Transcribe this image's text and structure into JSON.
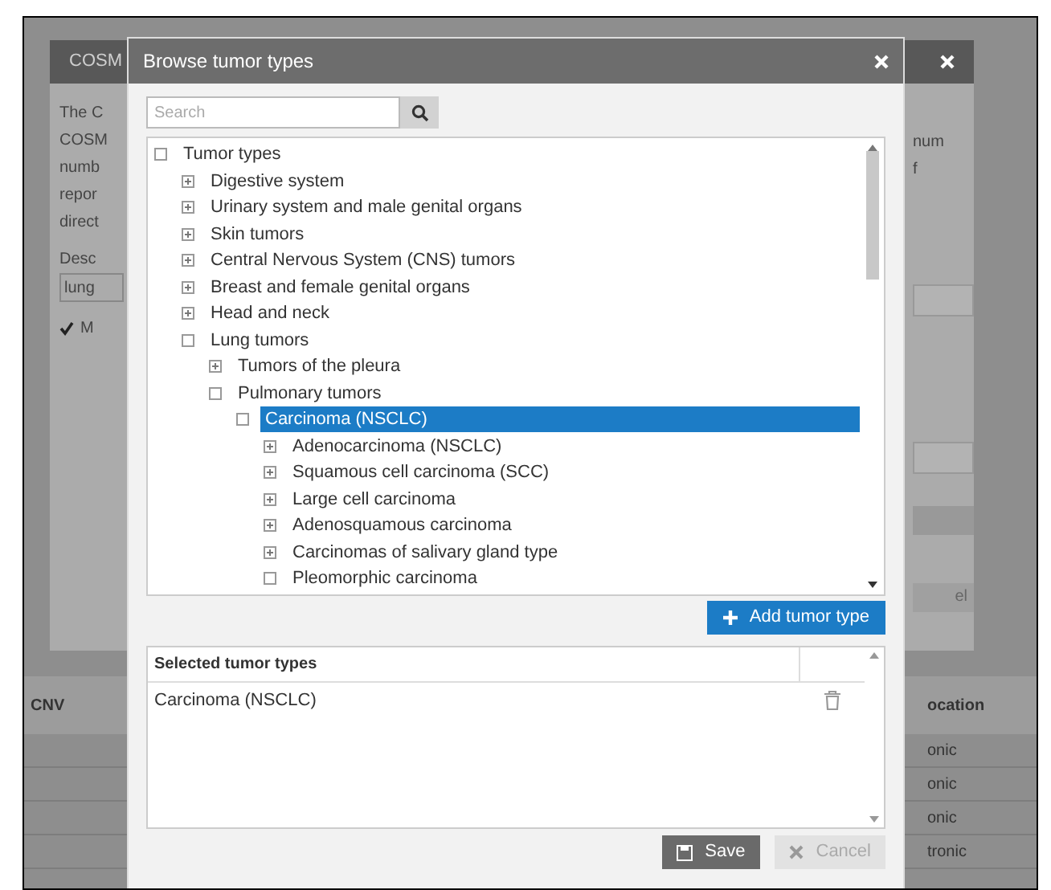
{
  "background_dialog": {
    "title": "COSM",
    "text_lines": [
      "The C",
      "COSM",
      "numb",
      "repor",
      "direct"
    ],
    "right_lines": [
      "num",
      "f"
    ],
    "description_label": "Desc",
    "description_value": "lung",
    "option": {
      "label": "M",
      "checked": true
    },
    "right_button": "el"
  },
  "background_table": {
    "columns": [
      "CNV",
      "ocation"
    ],
    "rows": [
      "onic",
      "onic",
      "onic",
      "tronic"
    ]
  },
  "dialog": {
    "title": "Browse tumor types",
    "search": {
      "placeholder": "Search"
    },
    "tree": [
      {
        "label": "Tumor types",
        "expanded": true,
        "selected": false,
        "children": [
          {
            "label": "Digestive system",
            "expanded": false,
            "selected": false
          },
          {
            "label": "Urinary system and male genital organs",
            "expanded": false,
            "selected": false
          },
          {
            "label": "Skin tumors",
            "expanded": false,
            "selected": false
          },
          {
            "label": "Central Nervous System (CNS) tumors",
            "expanded": false,
            "selected": false
          },
          {
            "label": "Breast and female genital organs",
            "expanded": false,
            "selected": false
          },
          {
            "label": "Head and neck",
            "expanded": false,
            "selected": false
          },
          {
            "label": "Lung tumors",
            "expanded": true,
            "selected": false,
            "children": [
              {
                "label": "Tumors of the pleura",
                "expanded": false,
                "selected": false
              },
              {
                "label": "Pulmonary tumors",
                "expanded": true,
                "selected": false,
                "children": [
                  {
                    "label": "Carcinoma (NSCLC)",
                    "expanded": true,
                    "selected": true,
                    "children": [
                      {
                        "label": "Adenocarcinoma (NSCLC)",
                        "expanded": false,
                        "selected": false
                      },
                      {
                        "label": "Squamous cell carcinoma (SCC)",
                        "expanded": false,
                        "selected": false
                      },
                      {
                        "label": "Large cell carcinoma",
                        "expanded": false,
                        "selected": false
                      },
                      {
                        "label": "Adenosquamous carcinoma",
                        "expanded": false,
                        "selected": false
                      },
                      {
                        "label": "Carcinomas of salivary gland type",
                        "expanded": false,
                        "selected": false
                      },
                      {
                        "label": "Pleomorphic carcinoma",
                        "expanded": true,
                        "selected": false
                      }
                    ]
                  }
                ]
              }
            ]
          }
        ]
      }
    ],
    "add_button": "Add tumor type",
    "selected_table": {
      "header": "Selected tumor types",
      "rows": [
        "Carcinoma (NSCLC)"
      ]
    },
    "buttons": [
      {
        "label": "Save",
        "kind": "save",
        "disabled": false
      },
      {
        "label": "Cancel",
        "kind": "cancel",
        "disabled": true
      }
    ]
  }
}
